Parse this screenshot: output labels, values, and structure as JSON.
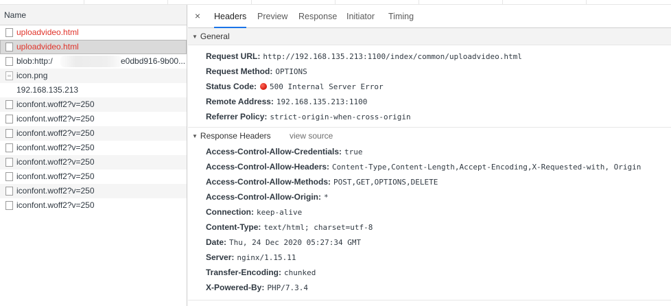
{
  "list": {
    "header": "Name",
    "rows": [
      {
        "name": "uploadvideo.html",
        "error": true,
        "icon": "file-icon"
      },
      {
        "name": "uploadvideo.html",
        "error": true,
        "selected": true,
        "icon": "file-icon"
      },
      {
        "name": "blob:http://192.168.135.213:1100/9e0dbd916-9b00...",
        "display": "blob:http:/",
        "tail": "e0dbd916-9b00...",
        "icon": "file-icon"
      },
      {
        "name": "icon.png",
        "icon": "image-icon"
      },
      {
        "name": "192.168.135.213",
        "icon": "none"
      },
      {
        "name": "iconfont.woff2?v=250",
        "icon": "file-icon"
      },
      {
        "name": "iconfont.woff2?v=250",
        "icon": "file-icon"
      },
      {
        "name": "iconfont.woff2?v=250",
        "icon": "file-icon"
      },
      {
        "name": "iconfont.woff2?v=250",
        "icon": "file-icon"
      },
      {
        "name": "iconfont.woff2?v=250",
        "icon": "file-icon"
      },
      {
        "name": "iconfont.woff2?v=250",
        "icon": "file-icon"
      },
      {
        "name": "iconfont.woff2?v=250",
        "icon": "file-icon"
      },
      {
        "name": "iconfont.woff2?v=250",
        "icon": "file-icon"
      }
    ]
  },
  "tabs": {
    "close": "×",
    "items": [
      "Headers",
      "Preview",
      "Response",
      "Initiator",
      "Timing"
    ],
    "active": "Headers"
  },
  "general": {
    "title": "General",
    "request_url_label": "Request URL:",
    "request_url": "http://192.168.135.213:1100/index/common/uploadvideo.html",
    "request_method_label": "Request Method:",
    "request_method": "OPTIONS",
    "status_code_label": "Status Code:",
    "status_code": "500 Internal Server Error",
    "remote_address_label": "Remote Address:",
    "remote_address": "192.168.135.213:1100",
    "referrer_policy_label": "Referrer Policy:",
    "referrer_policy": "strict-origin-when-cross-origin"
  },
  "response_headers": {
    "title": "Response Headers",
    "view_source": "view source",
    "items": [
      {
        "key": "Access-Control-Allow-Credentials:",
        "value": "true"
      },
      {
        "key": "Access-Control-Allow-Headers:",
        "value": "Content-Type,Content-Length,Accept-Encoding,X-Requested-with, Origin"
      },
      {
        "key": "Access-Control-Allow-Methods:",
        "value": "POST,GET,OPTIONS,DELETE"
      },
      {
        "key": "Access-Control-Allow-Origin:",
        "value": "*"
      },
      {
        "key": "Connection:",
        "value": "keep-alive"
      },
      {
        "key": "Content-Type:",
        "value": "text/html; charset=utf-8"
      },
      {
        "key": "Date:",
        "value": "Thu, 24 Dec 2020 05:27:34 GMT"
      },
      {
        "key": "Server:",
        "value": "nginx/1.15.11"
      },
      {
        "key": "Transfer-Encoding:",
        "value": "chunked"
      },
      {
        "key": "X-Powered-By:",
        "value": "PHP/7.3.4"
      }
    ]
  },
  "colors": {
    "error_text": "#e0332a",
    "active_tab_underline": "#1a73e8",
    "status_dot": "#d51a0f"
  }
}
